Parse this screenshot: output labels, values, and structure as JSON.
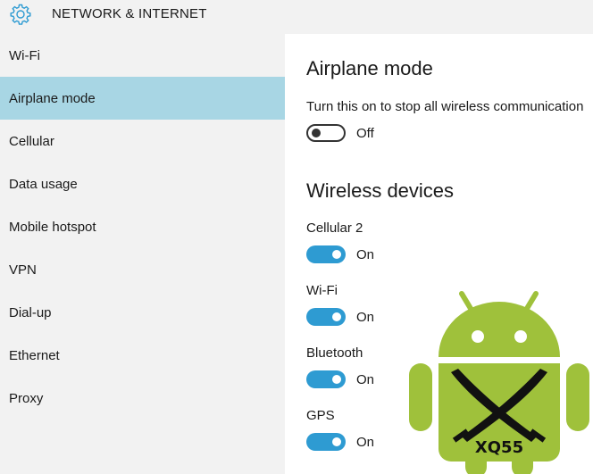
{
  "titlebar": {
    "title": "NETWORK & INTERNET",
    "icon": "gear-icon"
  },
  "sidebar": {
    "items": [
      {
        "label": "Wi-Fi"
      },
      {
        "label": "Airplane mode",
        "selected": true
      },
      {
        "label": "Cellular"
      },
      {
        "label": "Data usage"
      },
      {
        "label": "Mobile hotspot"
      },
      {
        "label": "VPN"
      },
      {
        "label": "Dial-up"
      },
      {
        "label": "Ethernet"
      },
      {
        "label": "Proxy"
      }
    ]
  },
  "main": {
    "airplane": {
      "heading": "Airplane mode",
      "description": "Turn this on to stop all wireless communication",
      "toggle_state": "Off"
    },
    "wireless": {
      "heading": "Wireless devices",
      "devices": [
        {
          "label": "Cellular 2",
          "state": "On"
        },
        {
          "label": "Wi-Fi",
          "state": "On"
        },
        {
          "label": "Bluetooth",
          "state": "On"
        },
        {
          "label": "GPS",
          "state": "On"
        }
      ]
    }
  },
  "watermark": {
    "text": "XQ55"
  },
  "colors": {
    "accent": "#2e9bd2",
    "selected": "#a8d6e4",
    "sidebar": "#f2f2f2",
    "android_green": "#9fc13b"
  }
}
